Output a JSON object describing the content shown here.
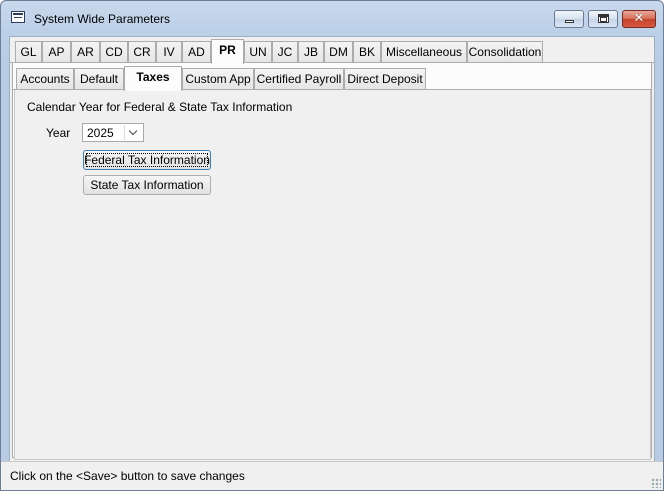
{
  "window": {
    "title": "System Wide Parameters"
  },
  "main_tabs": [
    {
      "label": "GL"
    },
    {
      "label": "AP"
    },
    {
      "label": "AR"
    },
    {
      "label": "CD"
    },
    {
      "label": "CR"
    },
    {
      "label": "IV"
    },
    {
      "label": "AD"
    },
    {
      "label": "PR"
    },
    {
      "label": "UN"
    },
    {
      "label": "JC"
    },
    {
      "label": "JB"
    },
    {
      "label": "DM"
    },
    {
      "label": "BK"
    },
    {
      "label": "Miscellaneous"
    },
    {
      "label": "Consolidation"
    }
  ],
  "active_main_tab": "PR",
  "sub_tabs": [
    {
      "label": "Accounts"
    },
    {
      "label": "Default"
    },
    {
      "label": "Taxes"
    },
    {
      "label": "Custom App"
    },
    {
      "label": "Certified Payroll"
    },
    {
      "label": "Direct Deposit"
    }
  ],
  "active_sub_tab": "Taxes",
  "taxes": {
    "section_label": "Calendar Year for Federal & State Tax Information",
    "year_label": "Year",
    "year_value": "2025",
    "federal_button": "Federal Tax Information",
    "state_button": "State Tax Information"
  },
  "status_bar": {
    "text": "Click on the <Save> button to save changes"
  },
  "icons": {
    "app": "window-form-icon",
    "minimize": "minimize-icon",
    "maximize": "maximize-icon",
    "close": "close-icon",
    "dropdown": "chevron-down-icon"
  },
  "colors": {
    "close_button": "#c3422b",
    "frame": "#b8cce4"
  }
}
